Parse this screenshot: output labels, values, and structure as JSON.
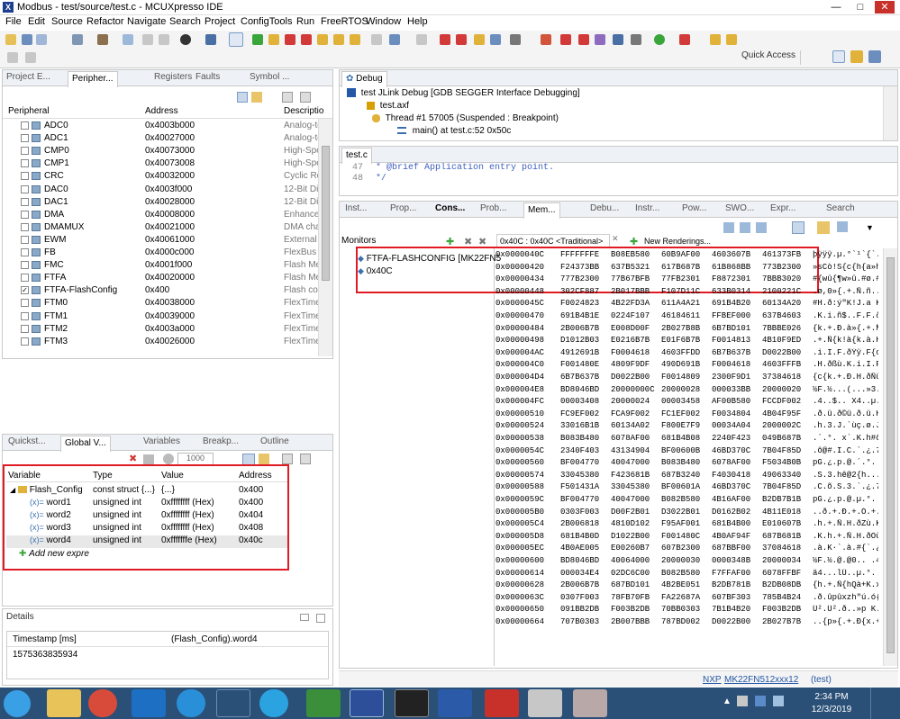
{
  "window": {
    "title": "Modbus - test/source/test.c - MCUXpresso IDE",
    "app_icon": "X"
  },
  "menu": [
    "File",
    "Edit",
    "Source",
    "Refactor",
    "Navigate",
    "Search",
    "Project",
    "ConfigTools",
    "Run",
    "FreeRTOS",
    "Window",
    "Help"
  ],
  "quick_access": "Quick Access",
  "left_top_tabs": [
    "Project E...",
    "Peripher...",
    "Registers",
    "Faults",
    "Symbol ..."
  ],
  "peripherals": {
    "headers": [
      "Peripheral",
      "Address",
      "Descriptio"
    ],
    "rows": [
      {
        "name": "ADC0",
        "addr": "0x4003b000",
        "desc": "Analog-to",
        "checked": false
      },
      {
        "name": "ADC1",
        "addr": "0x40027000",
        "desc": "Analog-to",
        "checked": false
      },
      {
        "name": "CMP0",
        "addr": "0x40073000",
        "desc": "High-Spee",
        "checked": false
      },
      {
        "name": "CMP1",
        "addr": "0x40073008",
        "desc": "High-Spee",
        "checked": false
      },
      {
        "name": "CRC",
        "addr": "0x40032000",
        "desc": "Cyclic Red",
        "checked": false
      },
      {
        "name": "DAC0",
        "addr": "0x4003f000",
        "desc": "12-Bit Digi",
        "checked": false
      },
      {
        "name": "DAC1",
        "addr": "0x40028000",
        "desc": "12-Bit Digi",
        "checked": false
      },
      {
        "name": "DMA",
        "addr": "0x40008000",
        "desc": "Enhanced",
        "checked": false
      },
      {
        "name": "DMAMUX",
        "addr": "0x40021000",
        "desc": "DMA char",
        "checked": false
      },
      {
        "name": "EWM",
        "addr": "0x40061000",
        "desc": "External W",
        "checked": false
      },
      {
        "name": "FB",
        "addr": "0x4000c000",
        "desc": "FlexBus ex",
        "checked": false
      },
      {
        "name": "FMC",
        "addr": "0x4001f000",
        "desc": "Flash Mem",
        "checked": false
      },
      {
        "name": "FTFA",
        "addr": "0x40020000",
        "desc": "Flash Mem",
        "checked": false
      },
      {
        "name": "FTFA-FlashConfig",
        "addr": "0x400",
        "desc": "Flash conf",
        "checked": true
      },
      {
        "name": "FTM0",
        "addr": "0x40038000",
        "desc": "FlexTimer",
        "checked": false
      },
      {
        "name": "FTM1",
        "addr": "0x40039000",
        "desc": "FlexTimer",
        "checked": false
      },
      {
        "name": "FTM2",
        "addr": "0x4003a000",
        "desc": "FlexTimer",
        "checked": false
      },
      {
        "name": "FTM3",
        "addr": "0x40026000",
        "desc": "FlexTimer",
        "checked": false
      }
    ]
  },
  "left_mid_tabs": [
    "Quickst...",
    "Global V...",
    "Variables",
    "Breakp...",
    "Outline"
  ],
  "globals": {
    "toolbar_value": "1000",
    "headers": [
      "Variable",
      "Type",
      "Value",
      "Address"
    ],
    "rows": [
      {
        "name": "Flash_Config",
        "type": "const struct {...}",
        "value": "{...}",
        "addr": "0x400",
        "indent": 0
      },
      {
        "name": "word1",
        "type": "unsigned int",
        "value": "0xffffffff (Hex)",
        "addr": "0x400",
        "indent": 1
      },
      {
        "name": "word2",
        "type": "unsigned int",
        "value": "0xffffffff (Hex)",
        "addr": "0x404",
        "indent": 1
      },
      {
        "name": "word3",
        "type": "unsigned int",
        "value": "0xffffffff (Hex)",
        "addr": "0x408",
        "indent": 1
      },
      {
        "name": "word4",
        "type": "unsigned int",
        "value": "0xfffffffe (Hex)",
        "addr": "0x40c",
        "indent": 1
      }
    ],
    "add_new": "Add new expre"
  },
  "details": {
    "title": "Details",
    "headers": [
      "Timestamp [ms]",
      "(Flash_Config).word4"
    ],
    "value": "1575363835934"
  },
  "debug": {
    "tab": "Debug",
    "launch": "test JLink Debug [GDB SEGGER Interface Debugging]",
    "axf": "test.axf",
    "thread": "Thread #1 57005 (Suspended : Breakpoint)",
    "frame": "main() at test.c:52 0x50c"
  },
  "editor": {
    "tab": "test.c",
    "lines": [
      {
        "num": "47",
        "text": "* @brief   Application entry point."
      },
      {
        "num": "48",
        "text": "*/"
      }
    ]
  },
  "bottom_tabs": [
    "Inst...",
    "Prop...",
    "Cons...",
    "Prob...",
    "Mem...",
    "Debu...",
    "Instr...",
    "Pow...",
    "SWO...",
    "Expr...",
    "Search"
  ],
  "memory": {
    "monitors_label": "Monitors",
    "monitors": [
      "FTFA-FLASHCONFIG [MK22FN5",
      "0x40C"
    ],
    "rendering_tab": "0x40C : 0x40C <Traditional>",
    "new_renderings": "New Renderings...",
    "rows": [
      [
        "0x0000040C",
        "FFFFFFFE",
        "B08EB580",
        "60B9AF00",
        "4603607B",
        "461373FB",
        "þÿÿÿ.µ.°`¹`{`.Fûs.F"
      ],
      [
        "0x00000420",
        "F24373BB",
        "637B5321",
        "617B687B",
        "61B868BB",
        "773B2300",
        "»sCò!S{c{h{a»h»a.#;w"
      ],
      [
        "0x00000434",
        "777B2300",
        "77B67BFB",
        "77FB2301",
        "F8872301",
        "7BBB3020",
        "#{wû{¶w»û.#ø.# 0»{"
      ],
      [
        "0x00000448",
        "302CF887",
        "2B017BBB",
        "F107D11C",
        "633B0314",
        "2100221C",
        ".ø,0»{.+.Ñ.ñ..;c.\".!"
      ],
      [
        "0x0000045C",
        "F0024823",
        "4B22FD3A",
        "611A4A21",
        "691B4B20",
        "60134A20",
        "#H.ð:ý\"K!J.a K.i J.`"
      ],
      [
        "0x00000470",
        "691B4B1E",
        "0224F107",
        "46184611",
        "FFBEF000",
        "637B4603",
        ".K.i.ñ$..F.F.ð¾ÿ.F{c"
      ],
      [
        "0x00000484",
        "2B006B7B",
        "E008D00F",
        "2B027B8B",
        "6B7BD101",
        "7BBBE026",
        "{k.+.Ð.à»{.+.Ñ{k&à»{"
      ],
      [
        "0x00000498",
        "D1012B03",
        "E0216B7B",
        "E01F6B7B",
        "F0014813",
        "4B10F9ED",
        ".+.Ñ{k!à{k.à.H.ðíù.K"
      ],
      [
        "0x000004AC",
        "4912691B",
        "F0004618",
        "4603FFDD",
        "6B7B637B",
        "D0022B00",
        ".i.I.F.ðÝÿ.F{c{k.+.Ð"
      ],
      [
        "0x000004C0",
        "F001480E",
        "4809F9DF",
        "490D691B",
        "F0004618",
        "4603FFFB",
        ".H.ðßù.K.i.I.F.ðûÿ.F"
      ],
      [
        "0x000004D4",
        "6B7B637B",
        "D0022B00",
        "F0014809",
        "2300F9D1",
        "37384618",
        "{c{k.+.Ð.H.ðÑù.#.F87"
      ],
      [
        "0x000004E8",
        "BD8046BD",
        "20000000C",
        "20000028",
        "000033BB",
        "20000020",
        "½F.½...(...»3..  ..."
      ],
      [
        "0x000004FC",
        "00003408",
        "20000024",
        "00003458",
        "AF00B580",
        "FCCDF002",
        ".4..$.. X4..µ.¯.ðÍü"
      ],
      [
        "0x00000510",
        "FC9EF002",
        "FCA9F002",
        "FC1EF002",
        "F0034804",
        "4B04F95F",
        ".ð.ü.ð©ü.ð.ü.H.ð_ù.K"
      ],
      [
        "0x00000524",
        "33016B1B",
        "60134A02",
        "F800E7F9",
        "00034A04",
        "2000002C",
        ".h.3.J.`ùç.ø.J.., .."
      ],
      [
        "0x00000538",
        "B083B480",
        "6078AF00",
        "681B4B08",
        "2240F423",
        "049B687B",
        ".´.°.¯x`.K.h#ô@\"{h.."
      ],
      [
        "0x0000054C",
        "2340F403",
        "43134904",
        "BF00600B",
        "46BD370C",
        "7B04F85D",
        ".ô@#.I.C.`.¿.7½F]ø.{"
      ],
      [
        "0x00000560",
        "BF004770",
        "40047000",
        "B083B480",
        "6078AF00",
        "F5034B0B",
        "pG.¿.p.@.´.°.¯x`.K.õ"
      ],
      [
        "0x00000574",
        "33045380",
        "F423681B",
        "687B3240",
        "F4030418",
        "49063340",
        ".S.3.hê@2{h...ô@3.I"
      ],
      [
        "0x00000588",
        "F501431A",
        "33045380",
        "BF00601A",
        "46BD370C",
        "7B04F85D",
        ".C.õ.S.3.`.¿.7½F]ø.{"
      ],
      [
        "0x0000059C",
        "BF004770",
        "40047000",
        "B082B580",
        "4B16AF00",
        "B2DB7B1B",
        "pG.¿.p.@.µ.°.¯.K.{Û²"
      ],
      [
        "0x000005B0",
        "0303F003",
        "D00F2B01",
        "D3022B01",
        "D0162B02",
        "4B11E018",
        "..ð.+.Ð.+.Ó.+.Ð.à.K"
      ],
      [
        "0x000005C4",
        "2B006818",
        "4810D102",
        "F95AF001",
        "681B4B00",
        "E010607B",
        ".h.+.Ñ.H.ðZù.K.h{`.à"
      ],
      [
        "0x000005D8",
        "681B4B0D",
        "D1022B00",
        "F001480C",
        "4B0AF94F",
        "687B681B",
        ".K.h.+.Ñ.H.ðOù.K.h{h"
      ],
      [
        "0x000005EC",
        "4B0AE005",
        "E00260B7",
        "607B2300",
        "687BBF00",
        "37084618",
        ".à.K·`.à.#{`.¿{h.F.7"
      ],
      [
        "0x00000600",
        "BD8046BD",
        "40064000",
        "20000030",
        "0000348B",
        "20000034",
        "½F.½.@.@0.. .4..4.. "
      ],
      [
        "0x00000614",
        "000034E4",
        "02DC6C00",
        "B082B580",
        "F7FFAF00",
        "6078FFBF",
        "ä4...lÜ..µ.°.¯ÿ÷¿ÿx`"
      ],
      [
        "0x00000628",
        "2B006B7B",
        "687BD101",
        "4B2BE051",
        "B2DB781B",
        "B2DB08DB",
        "{h.+.Ñ{hQà+K.x.ÛÛ.Û²"
      ],
      [
        "0x0000063C",
        "0307F003",
        "78FB70FB",
        "FA22687A",
        "607BF303",
        "785B4B24",
        ".ð.ûpûxzh\"ú.ó{`$K[x"
      ],
      [
        "0x00000650",
        "091BB2DB",
        "F003B2DB",
        "70BB0303",
        "7B1B4B20",
        "F003B2DB",
        "Û².Û².ð..»p K.{Û².ð"
      ],
      [
        "0x00000664",
        "707B0303",
        "2B007BBB",
        "787BD002",
        "D0022B00",
        "2B027B7B",
        "..{p»{.+.Ð{x.+.Ð{{.+"
      ]
    ]
  },
  "status": {
    "nxp": "NXP",
    "device": "MK22FN512xxx12",
    "project": "(test)"
  },
  "clock": {
    "time": "2:34 PM",
    "date": "12/3/2019"
  }
}
